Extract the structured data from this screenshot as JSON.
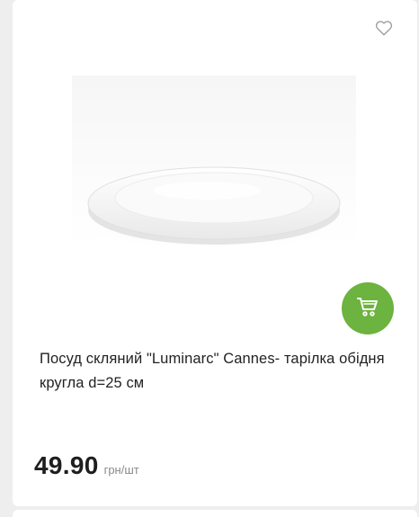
{
  "product": {
    "title": "Посуд скляний \"Luminarc\" Cannes- тарілка обідня кругла d=25 см",
    "price": "49.90",
    "unit": "грн/шт",
    "image_alt": "plate-image"
  },
  "icons": {
    "favorite": "heart-outline-icon",
    "cart": "shopping-cart-icon"
  },
  "colors": {
    "accent": "#6cb33f",
    "icon_gray": "#9a9a9a"
  }
}
